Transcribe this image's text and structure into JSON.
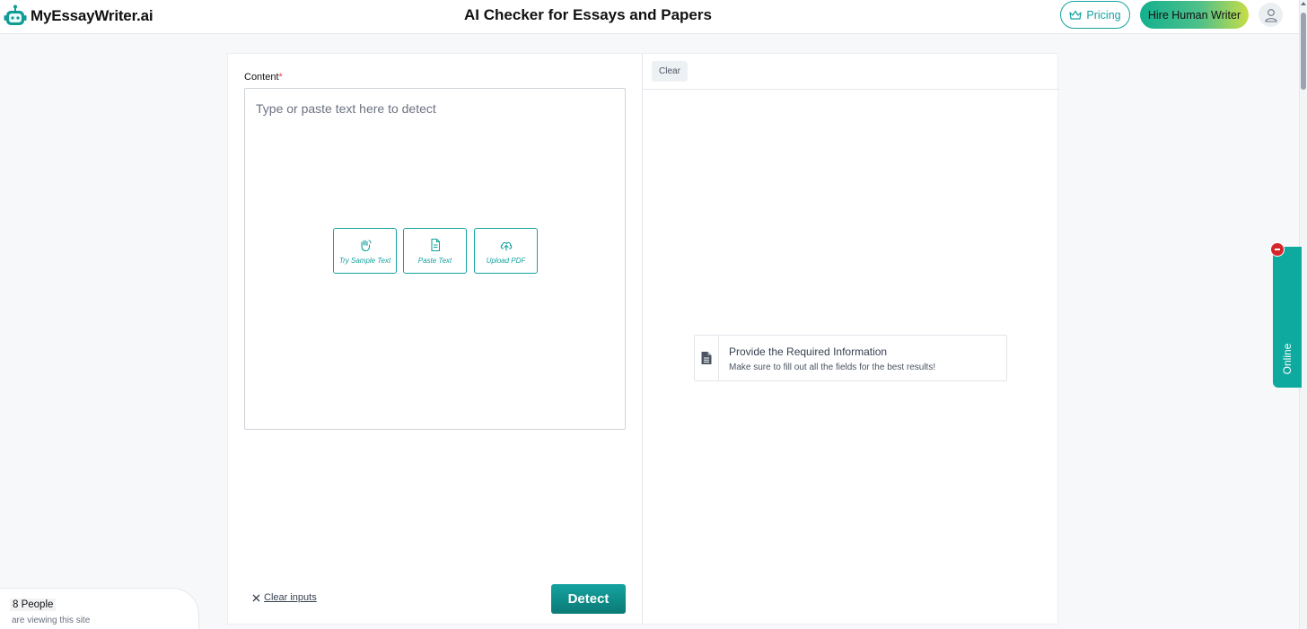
{
  "header": {
    "logo_text": "MyEssayWriter.ai",
    "title": "AI Checker for Essays and Papers",
    "pricing_label": "Pricing",
    "hire_label": "Hire Human Writer"
  },
  "colors": {
    "accent": "#14a3a0",
    "detect_button": "#0f8f8b",
    "online_tab": "#0faa9f",
    "badge_red": "#d7262b",
    "required_star": "#ef4444"
  },
  "form": {
    "content_label": "Content",
    "required_mark": "*",
    "placeholder": "Type or paste text here to detect",
    "actions": {
      "sample": "Try Sample Text",
      "paste": "Paste Text",
      "upload": "Upload PDF"
    },
    "clear_inputs_label": "Clear inputs",
    "detect_label": "Detect"
  },
  "results": {
    "clear_label": "Clear",
    "info_title": "Provide the Required Information",
    "info_subtitle": "Make sure to fill out all the fields for the best results!"
  },
  "online_tab": {
    "label": "Online"
  },
  "viewers": {
    "count": "8 People",
    "text": "are viewing this site"
  }
}
